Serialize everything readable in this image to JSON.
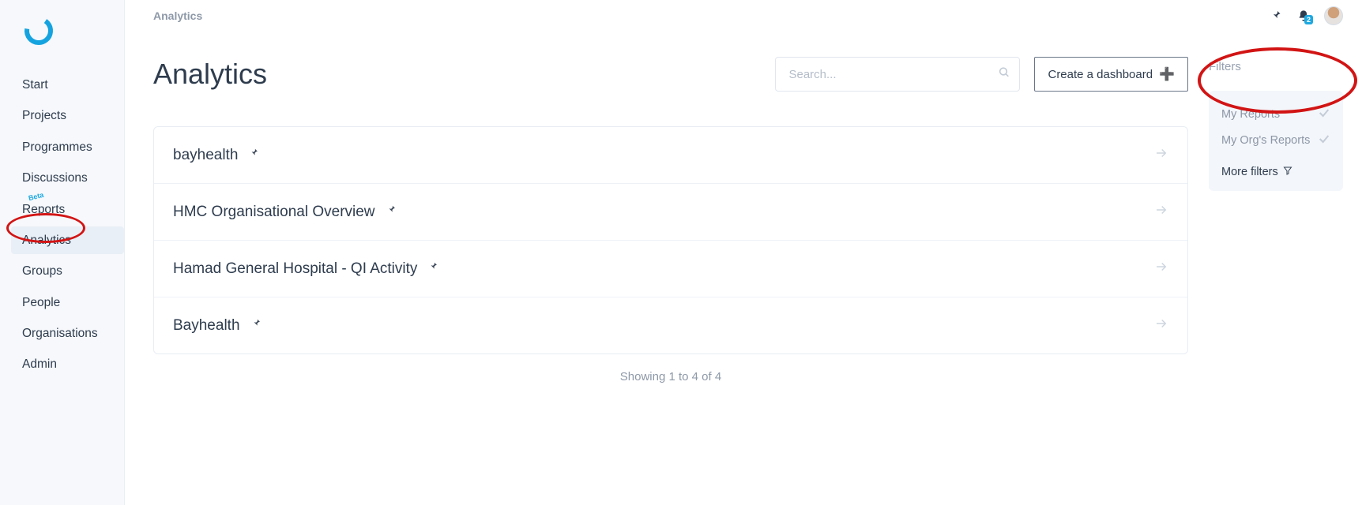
{
  "breadcrumb": "Analytics",
  "page_title": "Analytics",
  "search": {
    "placeholder": "Search..."
  },
  "create_button": "Create a dashboard",
  "notifications_count": "2",
  "sidebar": {
    "items": [
      {
        "label": "Start"
      },
      {
        "label": "Projects"
      },
      {
        "label": "Programmes"
      },
      {
        "label": "Discussions"
      },
      {
        "label": "Reports",
        "beta": "Beta"
      },
      {
        "label": "Analytics"
      },
      {
        "label": "Groups"
      },
      {
        "label": "People"
      },
      {
        "label": "Organisations"
      },
      {
        "label": "Admin"
      }
    ]
  },
  "dashboards": [
    {
      "title": "bayhealth"
    },
    {
      "title": "HMC Organisational Overview"
    },
    {
      "title": "Hamad General Hospital - QI Activity"
    },
    {
      "title": "Bayhealth"
    }
  ],
  "pager_text": "Showing 1 to 4 of 4",
  "filters": {
    "title": "Filters",
    "options": [
      {
        "label": "My Reports"
      },
      {
        "label": "My Org's Reports"
      }
    ],
    "more_label": "More filters"
  }
}
